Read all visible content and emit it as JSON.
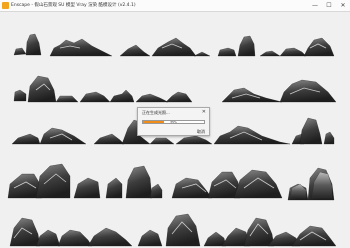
{
  "window": {
    "title": "Enscape - 假山石景观 SU 模型 Vray 渲染 酷模设计 (v2.4.1)",
    "minimize": "—",
    "maximize": "☐",
    "close": "✕",
    "icon_color": "#f2a51c"
  },
  "progress_dialog": {
    "title": "正在生成光照...",
    "close": "✕",
    "percent": 35,
    "percent_label": "35%",
    "cancel_label": "取消",
    "fill_color": "#f08c1a"
  }
}
